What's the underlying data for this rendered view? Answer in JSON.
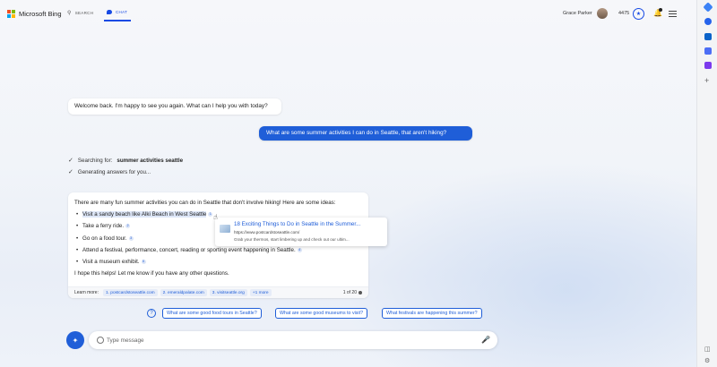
{
  "header": {
    "brand": "Microsoft Bing",
    "tabs": [
      {
        "label": "SEARCH",
        "active": false
      },
      {
        "label": "CHAT",
        "active": true
      }
    ],
    "user_name": "Grace Parker",
    "points": "4475"
  },
  "chat": {
    "welcome": "Welcome back. I'm happy to see you again. What can I help you with today?",
    "user_message": "What are some summer activities I can do in Seattle, that aren't hiking?",
    "progress": {
      "searching_label": "Searching for:",
      "searching_query": "summer activities seattle",
      "generating": "Generating answers for you..."
    },
    "answer": {
      "intro": "There are many fun summer activities you can do in Seattle that don't involve hiking! Here are some ideas:",
      "items": [
        {
          "text": "Visit a sandy beach like Alki Beach in West Seattle",
          "cite": "1"
        },
        {
          "text": "Take a ferry ride.",
          "cite": "2"
        },
        {
          "text": "Go on a food tour.",
          "cite": "3"
        },
        {
          "text": "Attend a festival, performance, concert, reading or sporting event happening in Seattle.",
          "cite": "4"
        },
        {
          "text": "Visit a museum exhibit.",
          "cite": "5"
        }
      ],
      "closing": "I hope this helps! Let me know if you have any other questions.",
      "learn_more_label": "Learn more:",
      "sources": [
        "1. postcardstoseattle.com",
        "2. emeraldpalate.com",
        "3. visitseattle.org",
        "+1 more"
      ],
      "page_count": "1 of 20"
    },
    "popover": {
      "title": "18 Exciting Things to Do in Seattle in the Summer...",
      "url": "https://www.postcardstoseattle.com/",
      "snippet": "Grab your thermos, start limbering up and check out our ultim..."
    },
    "suggestions": [
      "What are some good food tours in Seattle?",
      "What are some good museums to visit?",
      "What festivals are happening this summer?"
    ],
    "input_placeholder": "Type message"
  },
  "colors": {
    "accent": "#1f5ed8",
    "user_bubble": "#1f5ed8",
    "logo": [
      "#f25022",
      "#7fba00",
      "#00a4ef",
      "#ffb900"
    ]
  }
}
